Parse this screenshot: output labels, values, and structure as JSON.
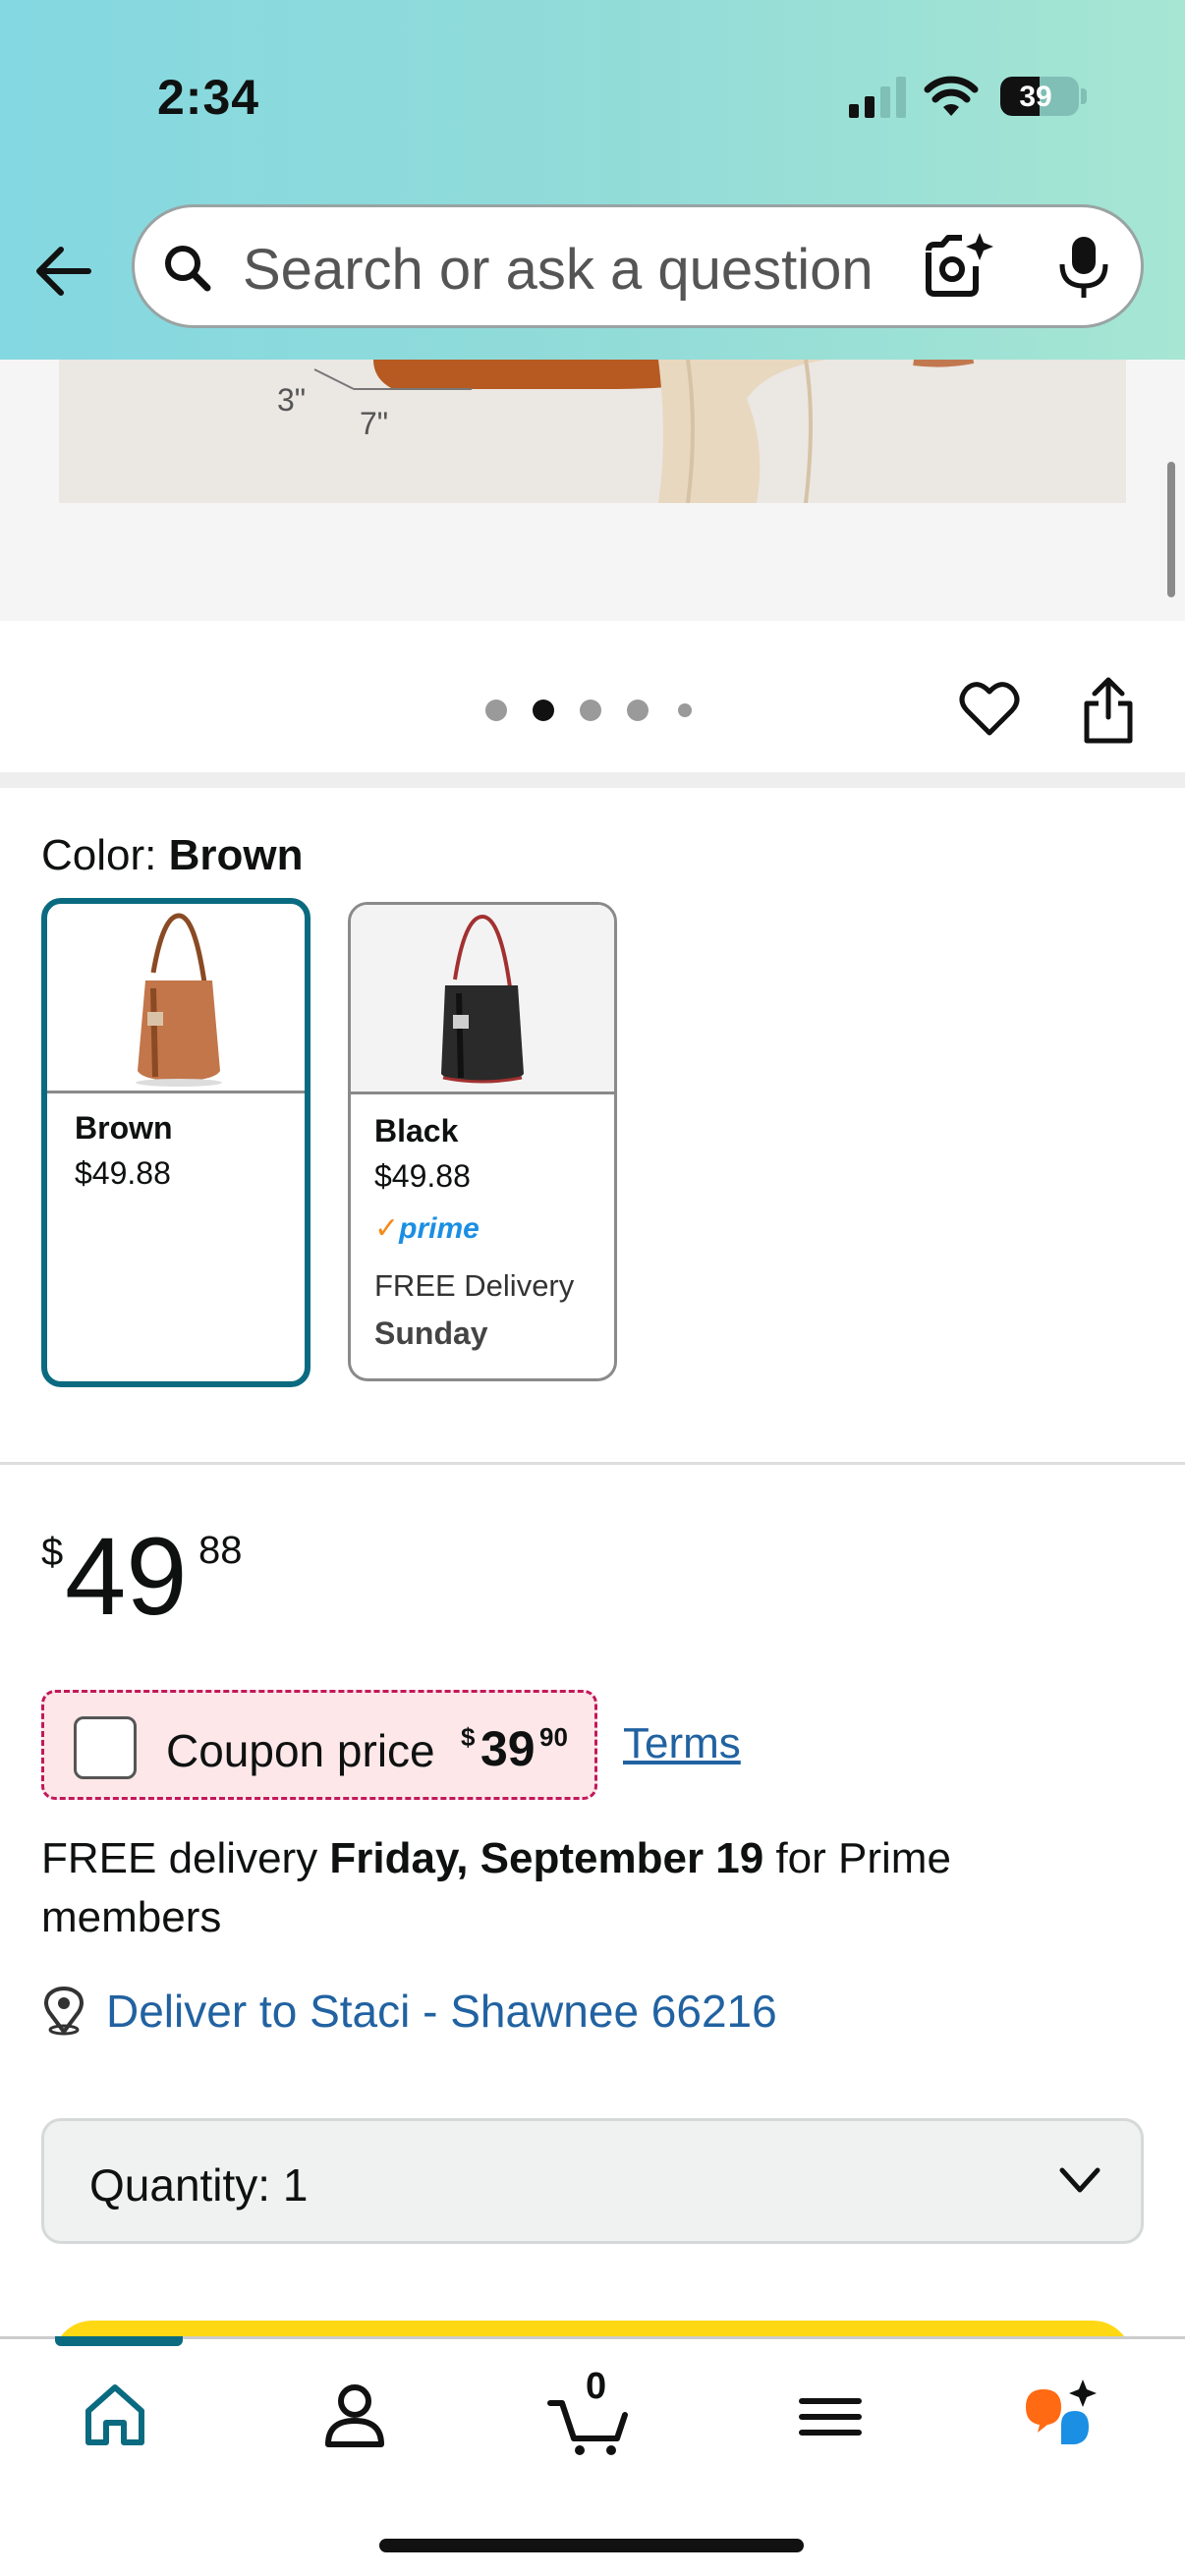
{
  "status_bar": {
    "time": "2:34",
    "battery": "39"
  },
  "search": {
    "placeholder": "Search or ask a question"
  },
  "product_image": {
    "dimension_labels": [
      "3\"",
      "7\""
    ]
  },
  "gallery": {
    "dots": 5,
    "active_index": 1
  },
  "color": {
    "label": "Color: ",
    "selected_value": "Brown",
    "options": [
      {
        "name": "Brown",
        "price": "$49.88",
        "selected": true,
        "color": "#b8683f"
      },
      {
        "name": "Black",
        "price": "$49.88",
        "prime": "prime",
        "delivery_line1": "FREE Delivery",
        "delivery_line2": "Sunday",
        "color": "#222222"
      }
    ]
  },
  "price": {
    "symbol": "$",
    "whole": "49",
    "fraction": "88"
  },
  "coupon": {
    "label": "Coupon price",
    "symbol": "$",
    "whole": "39",
    "fraction": "90",
    "terms": "Terms"
  },
  "delivery": {
    "prefix": "FREE delivery ",
    "date": "Friday, September 19",
    "suffix": " for Prime members"
  },
  "deliver_to": {
    "text": "Deliver to Staci - Shawnee 66216"
  },
  "quantity": {
    "label": "Quantity:",
    "value": "1"
  },
  "tabs": [
    {
      "name": "home",
      "icon": "home-icon",
      "active": true
    },
    {
      "name": "account",
      "icon": "person-icon"
    },
    {
      "name": "cart",
      "icon": "cart-icon",
      "count": "0"
    },
    {
      "name": "menu",
      "icon": "menu-icon"
    },
    {
      "name": "rufus",
      "icon": "rufus-icon"
    }
  ],
  "colors": {
    "accent": "#0a6b80",
    "link": "#2162a1",
    "buy": "#ffd814",
    "coupon_border": "#c2185b"
  }
}
